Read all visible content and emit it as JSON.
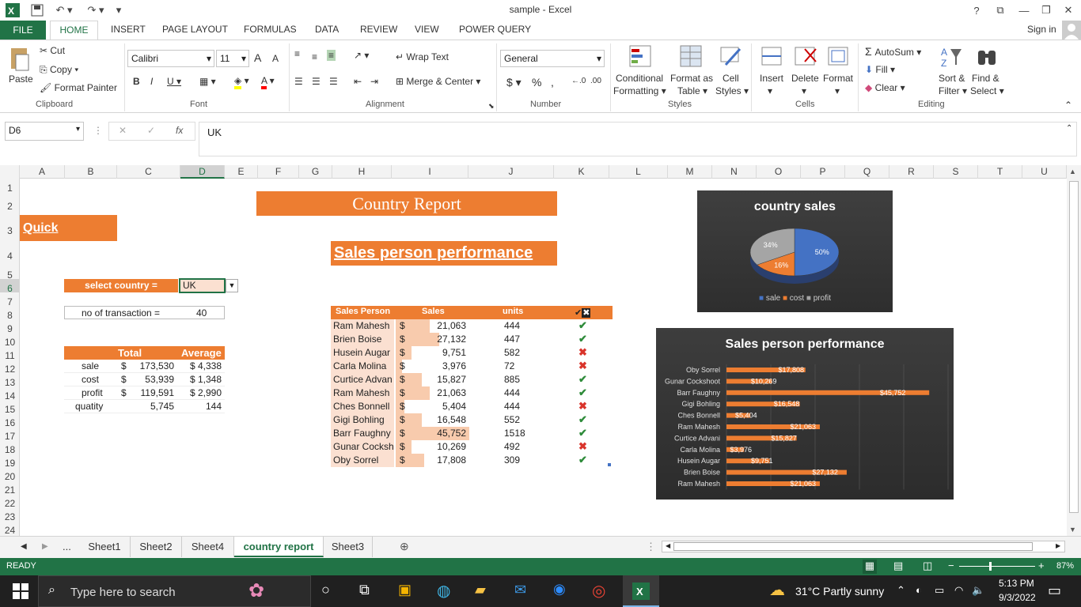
{
  "window": {
    "title": "sample - Excel",
    "sign_in": "Sign in"
  },
  "tabs": {
    "file": "FILE",
    "home": "HOME",
    "insert": "INSERT",
    "page_layout": "PAGE LAYOUT",
    "formulas": "FORMULAS",
    "data": "DATA",
    "review": "REVIEW",
    "view": "VIEW",
    "power_query": "POWER QUERY"
  },
  "clipboard": {
    "paste": "Paste",
    "cut": "Cut",
    "copy": "Copy",
    "format_painter": "Format Painter",
    "group": "Clipboard"
  },
  "font": {
    "name": "Calibri",
    "size": "11",
    "group": "Font"
  },
  "alignment": {
    "wrap_text": "Wrap Text",
    "merge_center": "Merge & Center",
    "group": "Alignment"
  },
  "number": {
    "format": "General",
    "group": "Number"
  },
  "styles": {
    "conditional": "Conditional",
    "formatting": "Formatting",
    "format_as": "Format as",
    "table": "Table",
    "cell": "Cell",
    "styles": "Styles",
    "group": "Styles"
  },
  "cells": {
    "insert": "Insert",
    "delete": "Delete",
    "format": "Format",
    "group": "Cells"
  },
  "editing": {
    "autosum": "AutoSum",
    "fill": "Fill",
    "clear": "Clear",
    "sort": "Sort &",
    "filter": "Filter",
    "find": "Find &",
    "select": "Select",
    "group": "Editing"
  },
  "formula_bar": {
    "name_box": "D6",
    "content": "UK",
    "fx": "fx"
  },
  "columns": [
    "A",
    "B",
    "C",
    "D",
    "E",
    "F",
    "G",
    "H",
    "I",
    "J",
    "K",
    "L",
    "M",
    "N",
    "O",
    "P",
    "Q",
    "R",
    "S",
    "T",
    "U"
  ],
  "rows": [
    "1",
    "2",
    "3",
    "4",
    "5",
    "6",
    "7",
    "8",
    "9",
    "10",
    "11",
    "12",
    "13",
    "14",
    "15",
    "16",
    "17",
    "18",
    "19",
    "20",
    "21",
    "22",
    "23",
    "24"
  ],
  "sheet": {
    "country_report_title": "Country Report",
    "quick_summary": "Quick summary",
    "sales_person_performance": "Sales person performance",
    "select_country_label": "select country =",
    "select_country_value": "UK",
    "no_transaction_label": "no of transaction =",
    "no_transaction_value": "40",
    "summary_headers": {
      "total": "Total",
      "average": "Average"
    },
    "summary_rows": [
      {
        "label": "sale",
        "cur": "$",
        "total": "173,530",
        "avg": "$ 4,338"
      },
      {
        "label": "cost",
        "cur": "$",
        "total": "53,939",
        "avg": "$ 1,348"
      },
      {
        "label": "profit",
        "cur": "$",
        "total": "119,591",
        "avg": "$ 2,990"
      },
      {
        "label": "quatity",
        "cur": "",
        "total": "5,745",
        "avg": "144"
      }
    ],
    "sp_headers": {
      "person": "Sales Person",
      "sales": "Sales",
      "units": "units"
    },
    "sp_rows": [
      {
        "name": "Ram Mahesh",
        "cur": "$",
        "sales": "21,063",
        "units": "444",
        "ok": true,
        "frac": 0.46
      },
      {
        "name": "Brien Boise",
        "cur": "$",
        "sales": "27,132",
        "units": "447",
        "ok": true,
        "frac": 0.59
      },
      {
        "name": "Husein Augar",
        "cur": "$",
        "sales": "9,751",
        "units": "582",
        "ok": false,
        "frac": 0.21
      },
      {
        "name": "Carla Molina",
        "cur": "$",
        "sales": "3,976",
        "units": "72",
        "ok": false,
        "frac": 0.09
      },
      {
        "name": "Curtice Advan",
        "cur": "$",
        "sales": "15,827",
        "units": "885",
        "ok": true,
        "frac": 0.35
      },
      {
        "name": "Ram Mahesh",
        "cur": "$",
        "sales": "21,063",
        "units": "444",
        "ok": true,
        "frac": 0.46
      },
      {
        "name": "Ches Bonnell",
        "cur": "$",
        "sales": "5,404",
        "units": "444",
        "ok": false,
        "frac": 0.12
      },
      {
        "name": "Gigi Bohling",
        "cur": "$",
        "sales": "16,548",
        "units": "552",
        "ok": true,
        "frac": 0.36
      },
      {
        "name": "Barr Faughny",
        "cur": "$",
        "sales": "45,752",
        "units": "1518",
        "ok": true,
        "frac": 1.0
      },
      {
        "name": "Gunar Cocksh",
        "cur": "$",
        "sales": "10,269",
        "units": "492",
        "ok": false,
        "frac": 0.22
      },
      {
        "name": "Oby Sorrel",
        "cur": "$",
        "sales": "17,808",
        "units": "309",
        "ok": true,
        "frac": 0.39
      }
    ]
  },
  "chart_data": [
    {
      "type": "pie",
      "title": "country sales",
      "labels": [
        "sale",
        "cost",
        "profit"
      ],
      "values": [
        50,
        16,
        34
      ],
      "data_labels": [
        "50%",
        "16%",
        "34%"
      ],
      "colors": [
        "#4472c4",
        "#ed7d31",
        "#a5a5a5"
      ],
      "legend": "bottom"
    },
    {
      "type": "bar",
      "title": "Sales person performance",
      "categories": [
        "Oby Sorrel",
        "Gunar Cockshoot",
        "Barr Faughny",
        "Gigi Bohling",
        "Ches Bonnell",
        "Ram Mahesh",
        "Curtice Advani",
        "Carla Molina",
        "Husein Augar",
        "Brien Boise",
        "Ram Mahesh"
      ],
      "values": [
        17808,
        10269,
        45752,
        16548,
        5404,
        21063,
        15827,
        3976,
        9751,
        27132,
        21063
      ],
      "data_labels": [
        "$17,808",
        "$10,269",
        "$45,752",
        "$16,548",
        "$5,404",
        "$21,063",
        "$15,827",
        "$3,976",
        "$9,751",
        "$27,132",
        "$21,063"
      ],
      "color": "#ed7d31",
      "xlim": [
        0,
        50000
      ]
    }
  ],
  "sheet_tabs": {
    "more": "...",
    "tabs": [
      "Sheet1",
      "Sheet2",
      "Sheet4",
      "country report",
      "Sheet3"
    ],
    "active": "country report"
  },
  "status": {
    "ready": "READY",
    "zoom": "87%"
  },
  "taskbar": {
    "search": "Type here to search",
    "weather": "31°C  Partly sunny",
    "time": "5:13 PM",
    "date": "9/3/2022"
  }
}
